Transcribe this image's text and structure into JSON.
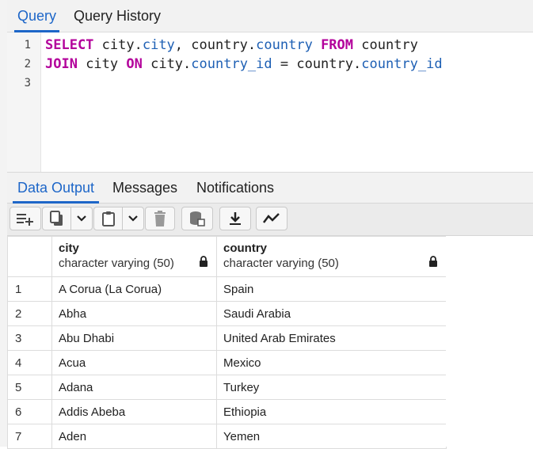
{
  "top_tabs": [
    {
      "label": "Query",
      "active": true
    },
    {
      "label": "Query History",
      "active": false
    }
  ],
  "editor": {
    "line_numbers": [
      "1",
      "2",
      "3"
    ],
    "line1": {
      "kw_select": "SELECT",
      "t1": " city.",
      "p1": "city",
      "t2": ", country.",
      "p2": "country",
      "t3": " ",
      "kw_from": "FROM",
      "t4": " country"
    },
    "line2": {
      "kw_join": "JOIN",
      "t1": " city ",
      "kw_on": "ON",
      "t2": " city.",
      "p1": "country_id",
      "t3": " = country.",
      "p2": "country_id"
    }
  },
  "output_tabs": [
    {
      "label": "Data Output",
      "active": true
    },
    {
      "label": "Messages",
      "active": false
    },
    {
      "label": "Notifications",
      "active": false
    }
  ],
  "toolbar": {
    "icons": [
      "add-row-icon",
      "copy-icon",
      "chevron-down-icon",
      "paste-icon",
      "chevron-down-icon",
      "delete-icon",
      "save-data-icon",
      "download-icon",
      "graph-icon"
    ]
  },
  "grid": {
    "columns": [
      {
        "name": "city",
        "type": "character varying (50)"
      },
      {
        "name": "country",
        "type": "character varying (50)"
      }
    ],
    "rows": [
      {
        "num": "1",
        "city": "A Corua (La Corua)",
        "country": "Spain"
      },
      {
        "num": "2",
        "city": "Abha",
        "country": "Saudi Arabia"
      },
      {
        "num": "3",
        "city": "Abu Dhabi",
        "country": "United Arab Emirates"
      },
      {
        "num": "4",
        "city": "Acua",
        "country": "Mexico"
      },
      {
        "num": "5",
        "city": "Adana",
        "country": "Turkey"
      },
      {
        "num": "6",
        "city": "Addis Abeba",
        "country": "Ethiopia"
      },
      {
        "num": "7",
        "city": "Aden",
        "country": "Yemen"
      }
    ]
  },
  "colors": {
    "accent": "#1d66c8",
    "keyword": "#b3009b",
    "property": "#1d5fb4"
  }
}
